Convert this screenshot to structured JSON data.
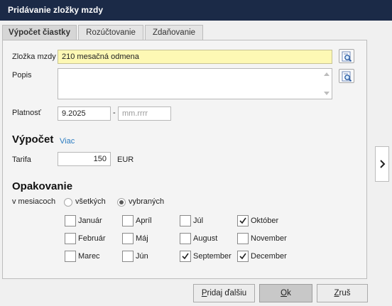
{
  "window": {
    "title": "Pridávanie zložky mzdy"
  },
  "tabs": [
    {
      "label": "Výpočet čiastky",
      "active": true
    },
    {
      "label": "Rozúčtovanie",
      "active": false
    },
    {
      "label": "Zdaňovanie",
      "active": false
    }
  ],
  "form": {
    "zlozka": {
      "label": "Zložka mzdy",
      "value": "210  mesačná odmena"
    },
    "popis": {
      "label": "Popis",
      "value": ""
    },
    "platnost": {
      "label": "Platnosť",
      "from": "9.2025",
      "separator": "-",
      "to_placeholder": "mm.rrrr"
    }
  },
  "vypocet": {
    "title": "Výpočet",
    "more_link": "Viac",
    "tarifa": {
      "label": "Tarifa",
      "value": "150",
      "unit": "EUR"
    }
  },
  "opakovanie": {
    "title": "Opakovanie",
    "months_label": "v mesiacoch",
    "radio_all": {
      "label": "všetkých",
      "selected": false
    },
    "radio_selected": {
      "label": "vybraných",
      "selected": true
    },
    "months": [
      {
        "label": "Január",
        "checked": false
      },
      {
        "label": "Február",
        "checked": false
      },
      {
        "label": "Marec",
        "checked": false
      },
      {
        "label": "Apríl",
        "checked": false
      },
      {
        "label": "Máj",
        "checked": false
      },
      {
        "label": "Jún",
        "checked": false
      },
      {
        "label": "Júl",
        "checked": false
      },
      {
        "label": "August",
        "checked": false
      },
      {
        "label": "September",
        "checked": true
      },
      {
        "label": "Október",
        "checked": true
      },
      {
        "label": "November",
        "checked": false
      },
      {
        "label": "December",
        "checked": true
      }
    ]
  },
  "buttons": {
    "add_another": {
      "prefix": "",
      "mnemonic": "P",
      "rest": "ridaj ďalšiu"
    },
    "ok": {
      "prefix": "",
      "mnemonic": "O",
      "rest": "k"
    },
    "cancel": {
      "prefix": "",
      "mnemonic": "Z",
      "rest": "ruš"
    }
  },
  "icons": {
    "lookup": "lookup-icon",
    "side_expand": "chevron-right-icon",
    "check": "check-icon"
  }
}
